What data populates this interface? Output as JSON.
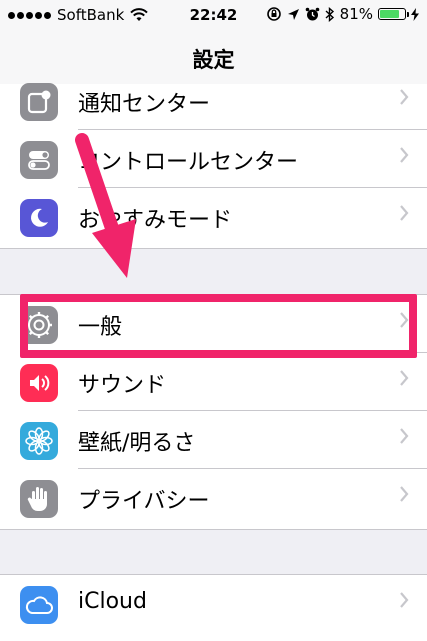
{
  "status_bar": {
    "carrier": "SoftBank",
    "time": "22:42",
    "battery": "81%",
    "battery_level": 0.81
  },
  "nav": {
    "title": "設定"
  },
  "groups": [
    {
      "items": [
        {
          "label": "通知センター",
          "icon": "notification-center-icon",
          "icon_bg": "#8e8e93"
        },
        {
          "label": "コントロールセンター",
          "icon": "control-center-icon",
          "icon_bg": "#8e8e93"
        },
        {
          "label": "おやすみモード",
          "icon": "do-not-disturb-moon-icon",
          "icon_bg": "#5856d6"
        }
      ]
    },
    {
      "items": [
        {
          "label": "一般",
          "icon": "gear-icon",
          "icon_bg": "#8e8e93"
        },
        {
          "label": "サウンド",
          "icon": "speaker-icon",
          "icon_bg": "#ff2d55"
        },
        {
          "label": "壁紙/明るさ",
          "icon": "flower-icon",
          "icon_bg": "#34aadc"
        },
        {
          "label": "プライバシー",
          "icon": "hand-icon",
          "icon_bg": "#8e8e93"
        }
      ]
    },
    {
      "items": [
        {
          "label": "iCloud",
          "icon": "cloud-icon",
          "icon_bg": "#3d8ff0"
        }
      ]
    }
  ],
  "annotation": {
    "color": "#f0246a"
  }
}
